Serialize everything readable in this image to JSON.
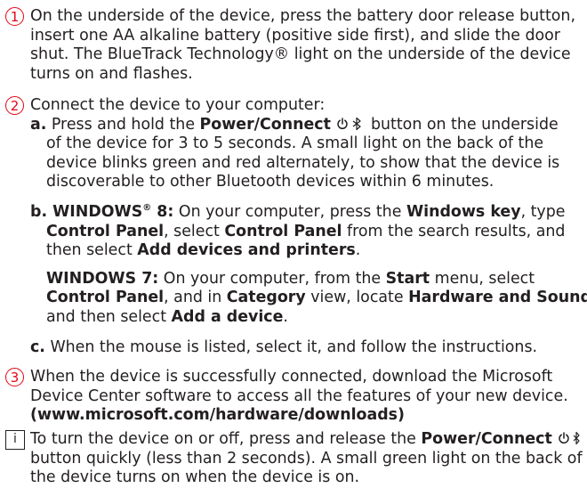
{
  "steps": [
    {
      "number": "1",
      "lines": [
        "On the underside of the device, press the battery door release button,",
        "insert one AA alkaline battery (positive side first), and slide the door",
        "shut. The BlueTrack Technology® light on the underside of the device",
        "turns on and flashes."
      ]
    },
    {
      "number": "2",
      "intro": "Connect the device to your computer:",
      "a": {
        "label": "a.",
        "l1_pre": "Press and hold the ",
        "l1_bold": "Power/Connect",
        "l1_post": " button on the underside",
        "lines": [
          "of the device for 3 to 5 seconds. A small light on the back of the",
          "device blinks green and red alternately, to show that the device is",
          "discoverable to other Bluetooth devices within 6 minutes."
        ]
      },
      "b": {
        "label": "b. WINDOWS",
        "label_sup": "®",
        "label_num": " 8:",
        "l1_pre": " On your computer, press the ",
        "l1_bold": "Windows key",
        "l1_post": ", type",
        "l2_bold1": "Control Panel",
        "l2_mid": ", select ",
        "l2_bold2": "Control Panel",
        "l2_post": " from the search results, and",
        "l3_pre": "then select ",
        "l3_bold": "Add devices and printers",
        "l3_post": "."
      },
      "win7": {
        "label": "WINDOWS 7:",
        "l1_pre": " On your computer, from the ",
        "l1_bold": "Start",
        "l1_post": " menu, select",
        "l2_bold1": "Control Panel",
        "l2_mid1": ", and in ",
        "l2_bold2": "Category",
        "l2_mid2": " view, locate ",
        "l2_bold3": "Hardware and Sound",
        "l2_post": ",",
        "l3_pre": "and then select ",
        "l3_bold": "Add a device",
        "l3_post": "."
      },
      "c": {
        "label": "c.",
        "text": " When the mouse is listed, select it, and follow the instructions."
      }
    },
    {
      "number": "3",
      "lines": [
        "When the device is successfully connected, download the Microsoft",
        "Device Center software to access all the features of your new device."
      ],
      "url": "(www.microsoft.com/hardware/downloads)"
    }
  ],
  "note": {
    "icon": "i",
    "l1_pre": "To turn the device on or off, press and release the ",
    "l1_bold": "Power/Connect",
    "lines": [
      "button quickly (less than 2 seconds). A small green light on the back of",
      "the device turns on when the device is on."
    ]
  },
  "icons": {
    "power": "power-icon",
    "bluetooth": "bluetooth-icon",
    "info": "info-icon"
  },
  "colors": {
    "step_number": "#e30613",
    "text": "#231f20"
  }
}
